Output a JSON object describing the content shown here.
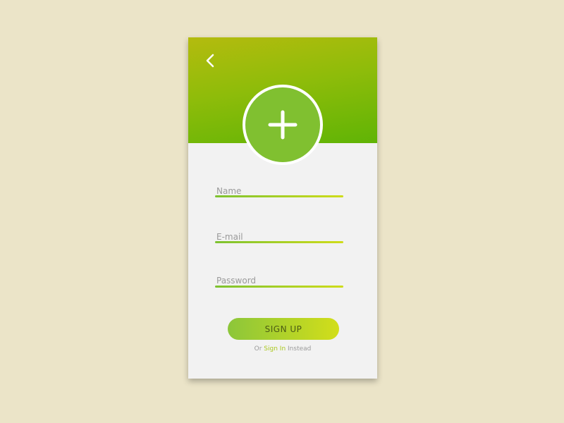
{
  "header": {
    "back_icon": "chevron-left-icon",
    "avatar_icon": "plus-icon"
  },
  "form": {
    "name_placeholder": "Name",
    "email_placeholder": "E-mail",
    "password_placeholder": "Password",
    "signup_label": "SIGN UP"
  },
  "footer": {
    "prefix": "Or",
    "signin_link": "Sign In",
    "suffix": "Instead"
  },
  "colors": {
    "page_background": "#ebe4c8",
    "card_background": "#f2f2f2",
    "header_gradient_top": "#b4bb0e",
    "header_gradient_bottom": "#60b405",
    "accent_green": "#80c030",
    "accent_yellow": "#d2de1a",
    "link_color": "#a9c81c"
  }
}
